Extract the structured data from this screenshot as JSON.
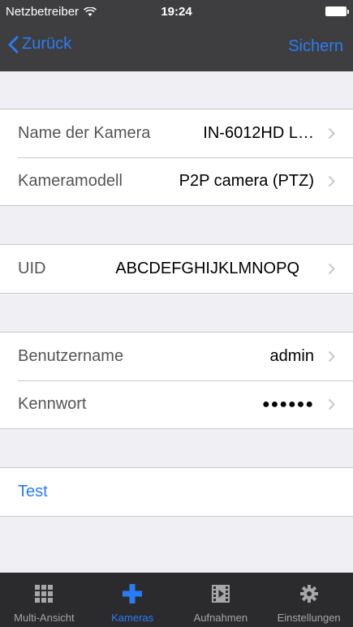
{
  "status_bar": {
    "carrier": "Netzbetreiber",
    "time": "19:24"
  },
  "nav": {
    "back_label": "Zurück",
    "save_label": "Sichern"
  },
  "camera_group": {
    "name_label": "Name der Kamera",
    "name_value": "IN-6012HD L…",
    "model_label": "Kameramodell",
    "model_value": "P2P camera (PTZ)"
  },
  "uid_group": {
    "uid_label": "UID",
    "uid_value": "ABCDEFGHIJKLMNOPQ"
  },
  "auth_group": {
    "username_label": "Benutzername",
    "username_value": "admin",
    "password_label": "Kennwort",
    "password_value": "●●●●●●"
  },
  "test_group": {
    "test_label": "Test"
  },
  "tabbar": {
    "tabs": [
      {
        "label": "Multi-Ansicht",
        "icon": "grid-icon"
      },
      {
        "label": "Kameras",
        "icon": "plus-icon",
        "active": true
      },
      {
        "label": "Aufnahmen",
        "icon": "film-icon"
      },
      {
        "label": "Einstellungen",
        "icon": "gear-icon"
      }
    ]
  },
  "colors": {
    "accent": "#2a7cf6",
    "header_bg": "#3e3e40",
    "tabbar_bg": "#2b2b2d",
    "background": "#efeff4"
  }
}
